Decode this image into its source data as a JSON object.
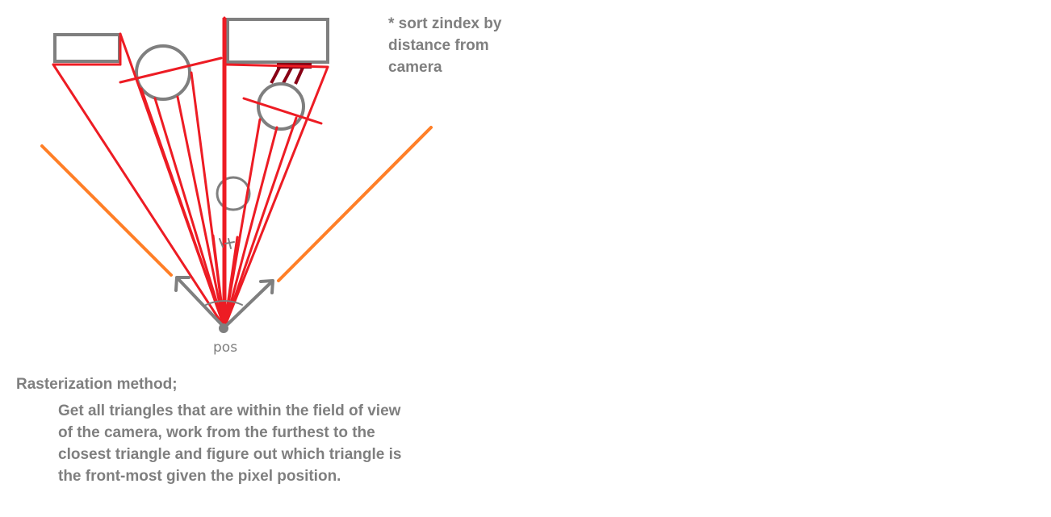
{
  "note": "* sort zindex by\ndistance from\ncamera",
  "heading": "Rasterization method;",
  "body": "Get all triangles that are within the field of view\nof the camera, work from the furthest to the\nclosest triangle and figure out which triangle is\nthe front-most given the pixel position.",
  "camera_label": "pos",
  "colors": {
    "ray": "#ed1c24",
    "fov": "#ff7f27",
    "shape": "#7f7f7f",
    "shadow": "#880015",
    "text": "#7f7f7f"
  }
}
